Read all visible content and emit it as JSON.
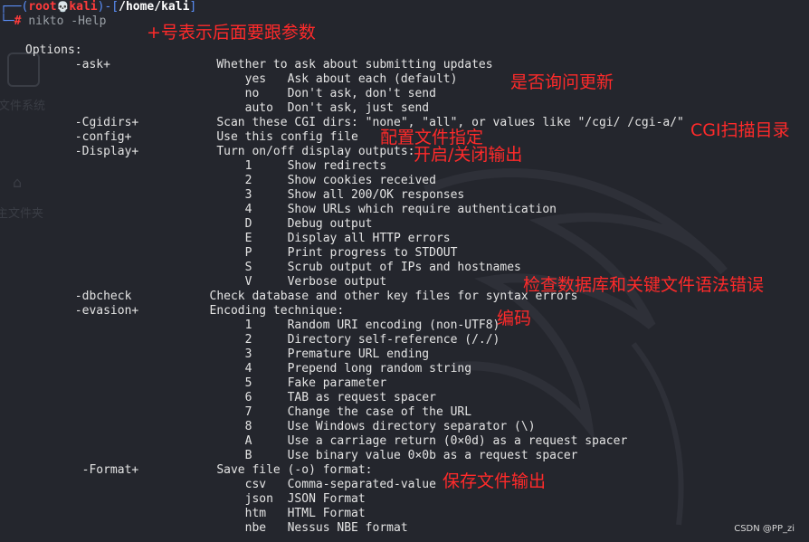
{
  "prompt": {
    "user": "root",
    "skull": "💀",
    "host": "kali",
    "path": "/home/kali",
    "hash": "#",
    "command": "nikto",
    "argument": "-Help"
  },
  "output_lines": [
    "Options:",
    "       -ask+               Whether to ask about submitting updates",
    "                               yes   Ask about each (default)",
    "                               no    Don't ask, don't send",
    "                               auto  Don't ask, just send",
    "       -Cgidirs+           Scan these CGI dirs: \"none\", \"all\", or values like \"/cgi/ /cgi-a/\"",
    "       -config+            Use this config file",
    "       -Display+           Turn on/off display outputs:",
    "                               1     Show redirects",
    "                               2     Show cookies received",
    "                               3     Show all 200/OK responses",
    "                               4     Show URLs which require authentication",
    "                               D     Debug output",
    "                               E     Display all HTTP errors",
    "                               P     Print progress to STDOUT",
    "                               S     Scrub output of IPs and hostnames",
    "                               V     Verbose output",
    "       -dbcheck           Check database and other key files for syntax errors",
    "       -evasion+          Encoding technique:",
    "                               1     Random URI encoding (non-UTF8)",
    "                               2     Directory self-reference (/./)",
    "                               3     Premature URL ending",
    "                               4     Prepend long random string",
    "                               5     Fake parameter",
    "                               6     TAB as request spacer",
    "                               7     Change the case of the URL",
    "                               8     Use Windows directory separator (\\)",
    "                               A     Use a carriage return (0×0d) as a request spacer",
    "                               B     Use binary value 0×0b as a request spacer",
    "        -Format+           Save file (-o) format:",
    "                               csv   Comma-separated-value",
    "                               json  JSON Format",
    "                               htm   HTML Format",
    "                               nbe   Nessus NBE format"
  ],
  "annotations": {
    "plus_note": "+号表示后面要跟参数",
    "update_note": "是否询问更新",
    "cgi_note": "CGI扫描目录",
    "config_note": "配置文件指定",
    "display_note": "开启/关闭输出",
    "dbcheck_note": "检查数据库和关键文件语法错误",
    "evasion_note": "编码",
    "format_note": "保存文件输出"
  },
  "desktop_labels": {
    "filesystem": "文件系统",
    "home": "主文件夹"
  },
  "watermark": "CSDN @PP_zi",
  "colors": {
    "background": "#24262d",
    "prompt_frame": "#5b8ff9",
    "root_user": "#ff3b3b",
    "annotation": "#ff2a2a"
  }
}
